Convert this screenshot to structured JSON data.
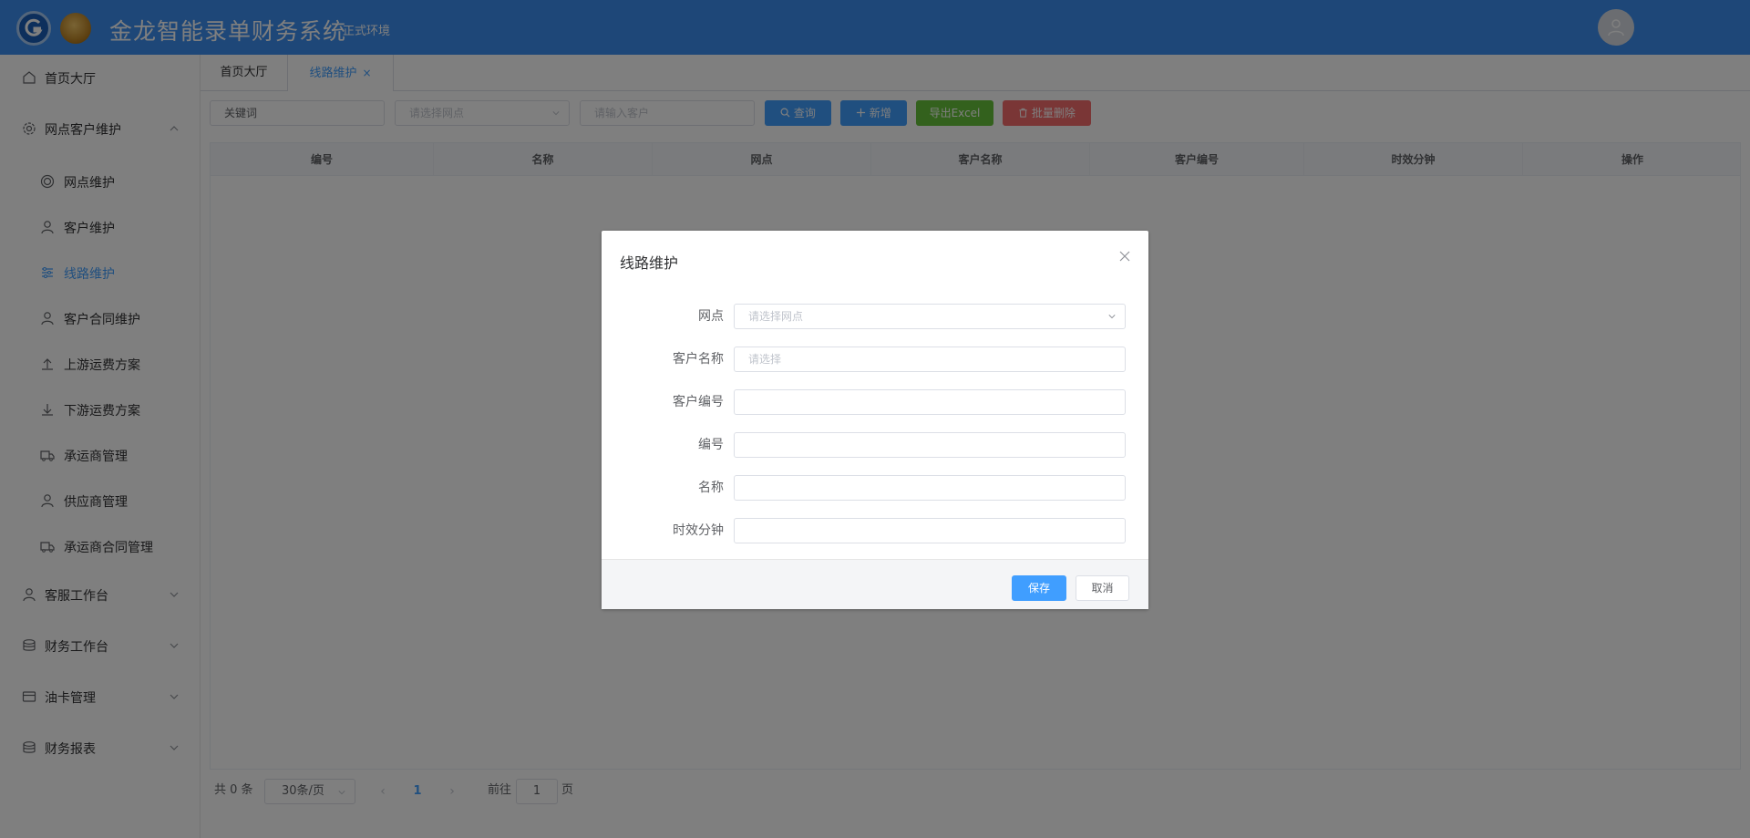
{
  "header": {
    "title": "金龙智能录单财务系统",
    "env": "正式环境"
  },
  "sidebar": {
    "items": [
      {
        "label": "首页大厅",
        "icon": "home-icon"
      },
      {
        "label": "网点客户维护",
        "icon": "gear-icon",
        "expanded": true
      },
      {
        "label": "网点维护",
        "icon": "target-icon"
      },
      {
        "label": "客户维护",
        "icon": "user-icon"
      },
      {
        "label": "线路维护",
        "icon": "sliders-icon",
        "active": true
      },
      {
        "label": "客户合同维护",
        "icon": "user-icon"
      },
      {
        "label": "上游运费方案",
        "icon": "upload-icon"
      },
      {
        "label": "下游运费方案",
        "icon": "download-icon"
      },
      {
        "label": "承运商管理",
        "icon": "truck-icon"
      },
      {
        "label": "供应商管理",
        "icon": "user-icon"
      },
      {
        "label": "承运商合同管理",
        "icon": "truck-icon"
      },
      {
        "label": "客服工作台",
        "icon": "user-icon"
      },
      {
        "label": "财务工作台",
        "icon": "coins-icon"
      },
      {
        "label": "油卡管理",
        "icon": "card-icon"
      },
      {
        "label": "财务报表",
        "icon": "coins-icon"
      }
    ]
  },
  "tabs": [
    {
      "label": "首页大厅"
    },
    {
      "label": "线路维护",
      "active": true,
      "close": "×"
    }
  ],
  "filters": {
    "keyword_value": "关键词",
    "site_placeholder": "请选择网点",
    "customer_placeholder": "请输入客户",
    "query_label": "查询",
    "add_label": "新增",
    "export_label": "导出Excel",
    "batch_delete_label": "批量删除"
  },
  "table": {
    "columns": [
      "编号",
      "名称",
      "网点",
      "客户名称",
      "客户编号",
      "时效分钟",
      "操作"
    ],
    "rows": []
  },
  "pagination": {
    "total_text": "共 0 条",
    "page_size": "30条/页",
    "current_page": "1",
    "goto_prefix": "前往",
    "goto_value": "1",
    "goto_suffix": "页"
  },
  "dialog": {
    "title": "线路维护",
    "fields": [
      {
        "label": "网点",
        "placeholder": "请选择网点",
        "type": "select"
      },
      {
        "label": "客户名称",
        "placeholder": "请选择",
        "type": "input"
      },
      {
        "label": "客户编号",
        "placeholder": "",
        "type": "input"
      },
      {
        "label": "编号",
        "placeholder": "",
        "type": "input"
      },
      {
        "label": "名称",
        "placeholder": "",
        "type": "input"
      },
      {
        "label": "时效分钟",
        "placeholder": "",
        "type": "input"
      }
    ],
    "save_label": "保存",
    "cancel_label": "取消"
  },
  "colors": {
    "header_bg": "#3d8ff0",
    "primary": "#409eff",
    "success": "#67c23a",
    "danger": "#f56c6c"
  }
}
